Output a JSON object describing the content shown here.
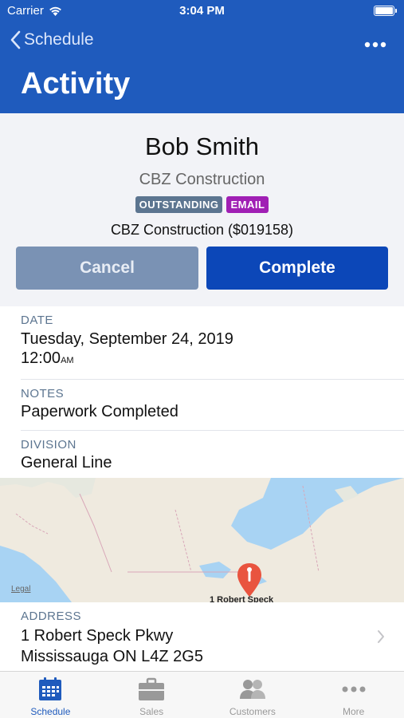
{
  "status_bar": {
    "carrier": "Carrier",
    "time": "3:04 PM"
  },
  "nav": {
    "back_label": "Schedule",
    "title": "Activity"
  },
  "contact": {
    "name": "Bob Smith",
    "company": "CBZ Construction",
    "badges": [
      "OUTSTANDING",
      "EMAIL"
    ],
    "job": "CBZ Construction ($019158)"
  },
  "actions": {
    "cancel_label": "Cancel",
    "complete_label": "Complete"
  },
  "fields": {
    "date_label": "DATE",
    "date_value": "Tuesday, September 24, 2019",
    "time_value": "12:00",
    "time_suffix": "AM",
    "notes_label": "NOTES",
    "notes_value": "Paperwork Completed",
    "division_label": "DIVISION",
    "division_value": "General Line"
  },
  "map": {
    "legal": "Legal",
    "pin_label": "1 Robert Speck"
  },
  "address": {
    "label": "ADDRESS",
    "line1": "1 Robert Speck Pkwy",
    "line2": "Mississauga ON  L4Z 2G5"
  },
  "tabs": [
    {
      "label": "Schedule",
      "icon": "calendar-icon",
      "active": true
    },
    {
      "label": "Sales",
      "icon": "briefcase-icon",
      "active": false
    },
    {
      "label": "Customers",
      "icon": "people-icon",
      "active": false
    },
    {
      "label": "More",
      "icon": "more-dots-icon",
      "active": false
    }
  ],
  "colors": {
    "accent": "#1f5bbd",
    "badge_outstanding": "#5c7590",
    "badge_email": "#a01fb4",
    "map_pin": "#e9543f"
  }
}
